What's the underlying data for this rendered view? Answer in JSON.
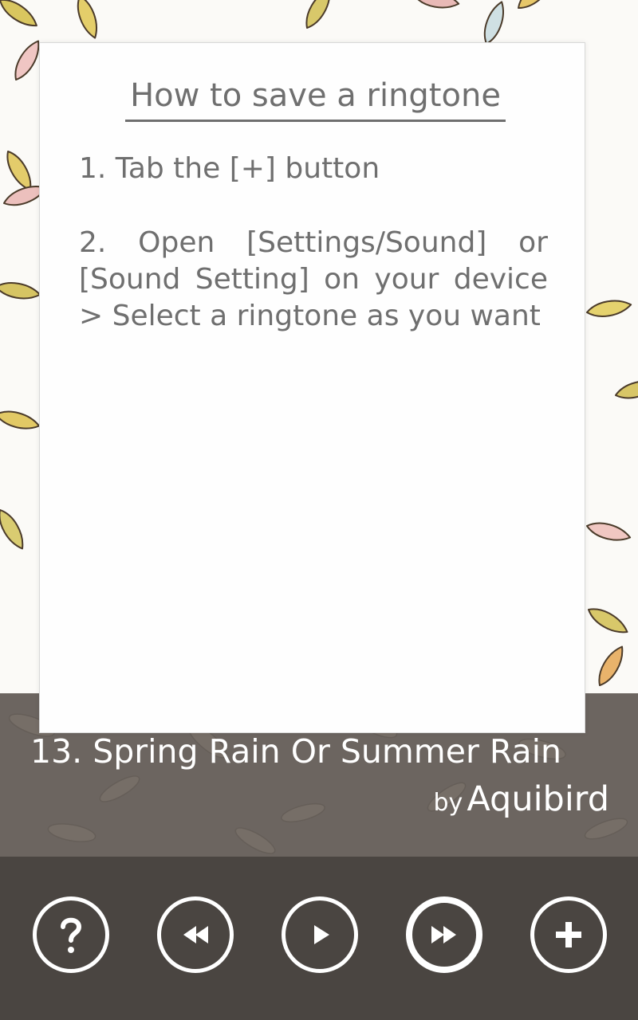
{
  "dialog": {
    "title": "How to save a ringtone",
    "step1": "1. Tab the [+] button",
    "step2": "2. Open [Settings/Sound] or [Sound Setting] on your device > Select a ringtone as you want"
  },
  "now_playing": {
    "title": "13. Spring Rain Or Summer Rain",
    "by_label": "by",
    "artist": "Aquibird"
  },
  "controls": [
    {
      "icon": "question-icon",
      "action": "help"
    },
    {
      "icon": "rewind-icon",
      "action": "previous"
    },
    {
      "icon": "play-icon",
      "action": "play"
    },
    {
      "icon": "fast-forward-icon",
      "action": "next"
    },
    {
      "icon": "plus-icon",
      "action": "add"
    }
  ],
  "colors": {
    "background": "#fbfaf7",
    "dialog_text": "#6f6f6f",
    "song_strip": "#6c6560",
    "controls_bar": "#4a4541",
    "control_icon": "#ffffff"
  }
}
